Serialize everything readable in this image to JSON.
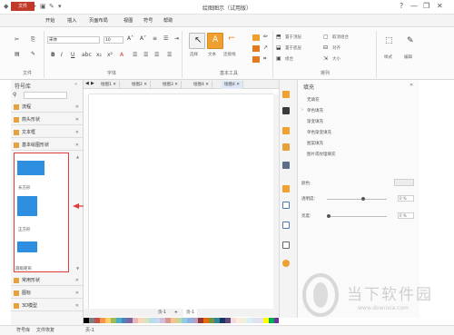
{
  "window": {
    "title": "绘图图示（试用版）",
    "quick_access": [
      "⊡",
      "↶",
      "↷",
      "▣",
      "✎",
      "▾"
    ],
    "controls": [
      "?",
      "—",
      "❐",
      "✕"
    ]
  },
  "menu": {
    "file": "文件",
    "items": [
      "开始",
      "插入",
      "页面布局",
      "视图",
      "符号",
      "帮助"
    ]
  },
  "ribbon": {
    "font_name": "宋体",
    "font_size": "10",
    "groups": [
      "文件",
      "字体",
      "基本工具",
      "排列",
      "样式"
    ],
    "tools": {
      "select": "选择",
      "text": "文本",
      "connector": "连接线"
    },
    "arrange_items": [
      "置于顶层",
      "置于底层",
      "组合",
      "取消组合",
      "对齐",
      "大小"
    ],
    "style_label": "样式",
    "edit_label": "编辑"
  },
  "left_panel": {
    "title": "符号库",
    "libraries_top": [
      "流程",
      "箭头形状",
      "文本框",
      "基本绘图形状"
    ],
    "shapes": [
      "长方形",
      "正方形",
      "圆角矩形"
    ],
    "libraries_bottom": [
      "常用形状",
      "图标",
      "3D模型"
    ],
    "bottom_tabs": [
      "符号库",
      "文件恢复"
    ]
  },
  "tabs": [
    "绘图1",
    "绘图2",
    "绘图3",
    "绘图4"
  ],
  "page_tabs": [
    "页-1",
    "+",
    "页-1"
  ],
  "right_panel": {
    "title": "填充",
    "fill_options": [
      "无填充",
      "单色填充",
      "渐变填充",
      "单色渐变填充",
      "图案填充",
      "图片或纹理填充"
    ],
    "color_label": "颜色:",
    "transparency_label": "透明度:",
    "transparency_value": "0 %",
    "brightness_label": "亮度:",
    "brightness_value": "0 %"
  },
  "status": {
    "page": "页-1"
  },
  "watermark": {
    "text": "当下软件园",
    "url": "www.downxia.com"
  },
  "colors": {
    "accent_red": "#c0392b",
    "shape_blue": "#2e8fe0",
    "highlight": "#e03c3c"
  }
}
